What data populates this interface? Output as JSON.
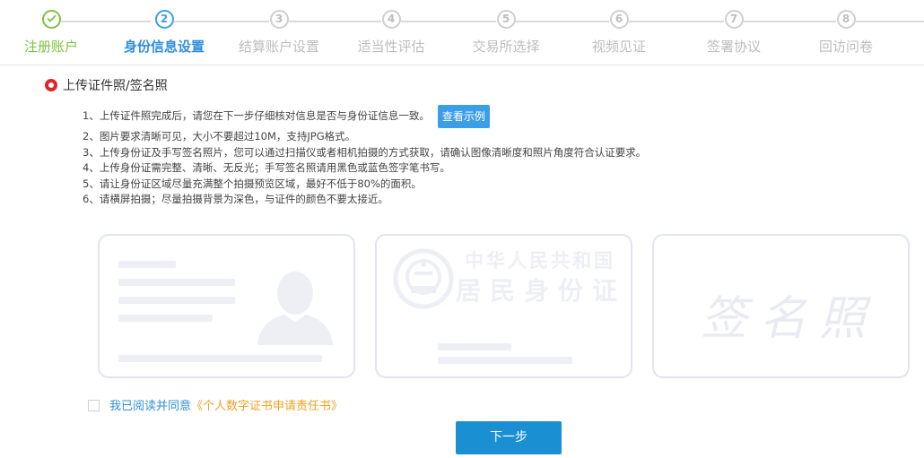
{
  "steps": [
    {
      "num": "1",
      "label": "注册账户",
      "state": "done"
    },
    {
      "num": "2",
      "label": "身份信息设置",
      "state": "active"
    },
    {
      "num": "3",
      "label": "结算账户设置",
      "state": "todo"
    },
    {
      "num": "4",
      "label": "适当性评估",
      "state": "todo"
    },
    {
      "num": "5",
      "label": "交易所选择",
      "state": "todo"
    },
    {
      "num": "6",
      "label": "视频见证",
      "state": "todo"
    },
    {
      "num": "7",
      "label": "签署协议",
      "state": "todo"
    },
    {
      "num": "8",
      "label": "回访问卷",
      "state": "todo"
    }
  ],
  "section": {
    "title": "上传证件照/签名照"
  },
  "instructions": [
    "1、上传证件照完成后，请您在下一步仔细核对信息是否与身份证信息一致。",
    "2、图片要求清晰可见，大小不要超过10M，支持JPG格式。",
    "3、上传身份证及手写签名照片，您可以通过扫描仪或者相机拍摄的方式获取，请确认图像清晰度和照片角度符合认证要求。",
    "4、上传身份证需完整、清晰、无反光；手写签名照请用黑色或蓝色签字笔书写。",
    "5、请让身份证区域尽量充满整个拍摄预览区域，最好不低于80%的面积。",
    "6、请横屏拍摄；尽量拍摄背景为深色，与证件的颜色不要太接近。"
  ],
  "example_button": "查看示例",
  "cards": {
    "id_back": {
      "line1": "中华人民共和国",
      "line2": "居民身份证"
    },
    "signature": {
      "text": "签名照"
    }
  },
  "agreement": {
    "text": "我已阅读并同意",
    "link": "《个人数字证书申请责任书》"
  },
  "next_button": "下一步",
  "colors": {
    "done": "#7cc242",
    "active": "#3d9ee8",
    "pending": "#cfcfcf",
    "primary": "#1a90d2",
    "link": "#f0a020"
  }
}
